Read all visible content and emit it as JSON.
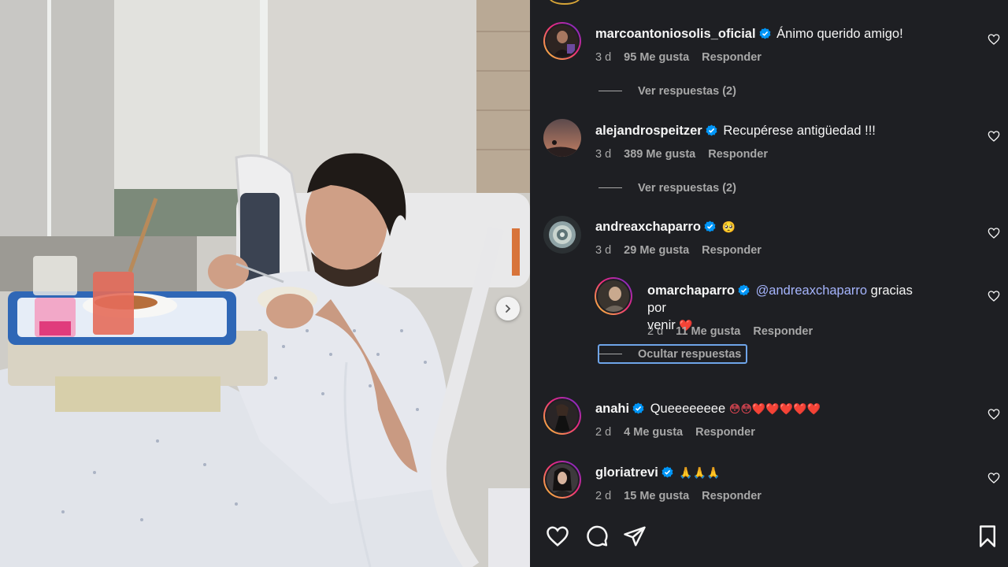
{
  "post": {
    "nav_next_icon": "chevron-right-icon"
  },
  "comments": [
    {
      "username": "marcoantoniosolis_oficial",
      "text": "Ánimo querido amigo!",
      "time": "3 d",
      "likes": "95 Me gusta",
      "reply_label": "Responder",
      "view_replies": "Ver respuestas (2)"
    },
    {
      "username": "alejandrospeitzer",
      "text": "Recupérese antigüedad !!!",
      "time": "3 d",
      "likes": "389 Me gusta",
      "reply_label": "Responder",
      "view_replies": "Ver respuestas (2)"
    },
    {
      "username": "andreaxchaparro",
      "text": "🥺",
      "time": "3 d",
      "likes": "29 Me gusta",
      "reply_label": "Responder",
      "reply": {
        "username": "omarchaparro",
        "mention": "@andreaxchaparro",
        "text": "gracias por",
        "text2": "venir",
        "emoji": "❤️",
        "time": "2 d",
        "likes": "11 Me gusta",
        "reply_label": "Responder"
      },
      "hide_replies": "Ocultar respuestas"
    },
    {
      "username": "anahi",
      "text": "Queeeeeeee",
      "emojis": "😳😳❤️❤️❤️❤️❤️",
      "time": "2 d",
      "likes": "4 Me gusta",
      "reply_label": "Responder"
    },
    {
      "username": "gloriatrevi",
      "text": "🙏🙏🙏",
      "time": "2 d",
      "likes": "15 Me gusta",
      "reply_label": "Responder"
    }
  ],
  "actions": [
    "heart-icon",
    "comment-icon",
    "share-icon",
    "bookmark-icon"
  ],
  "colors": {
    "background": "#1e1f23",
    "verified": "#0095f6",
    "mention": "#a5b4fc",
    "muted": "#a8a8a8"
  }
}
